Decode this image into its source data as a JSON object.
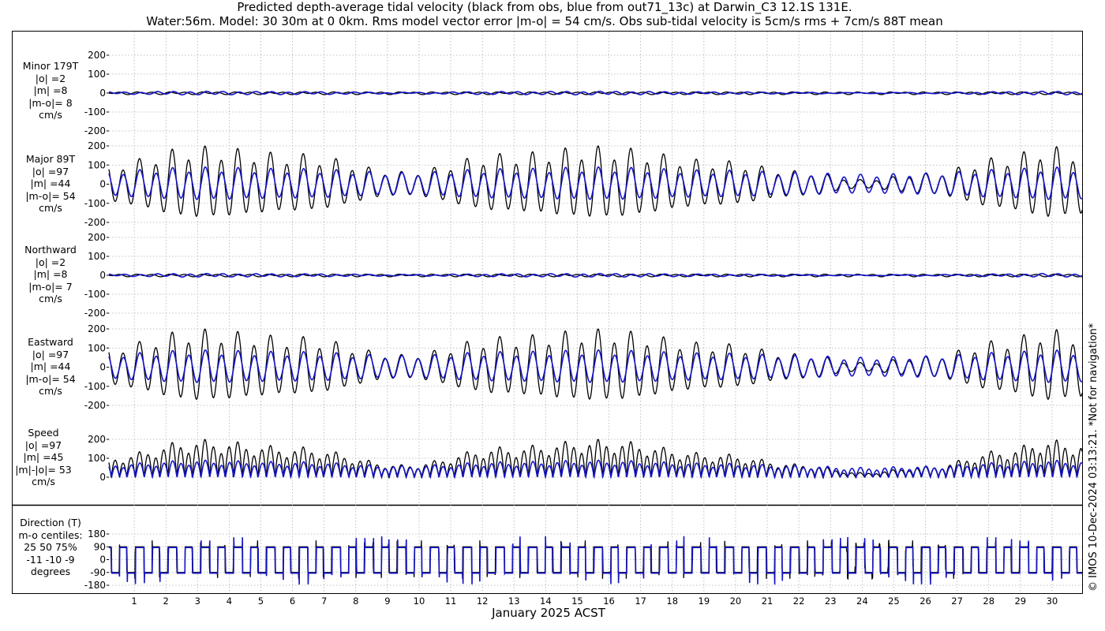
{
  "title": {
    "line1": "Predicted depth-average tidal velocity (black from obs, blue from out71_13c) at Darwin_C3 12.1S 131E.",
    "line2": "Water:56m. Model: 30 30m at 0 0km. Rms model vector error |m-o| = 54 cm/s. Obs sub-tidal velocity is 5cm/s rms + 7cm/s 88T mean"
  },
  "credit": "© IMOS 10-Dec-2024 03:13:21. *Not for navigation*",
  "colors": {
    "obs": "#000000",
    "model": "#1515c8",
    "grid": "#b0b0b0"
  },
  "chart_data": {
    "type": "line",
    "xlabel": "January 2025 ACST",
    "x_ticks": [
      "1",
      "2",
      "3",
      "4",
      "5",
      "6",
      "7",
      "8",
      "9",
      "10",
      "11",
      "12",
      "13",
      "14",
      "15",
      "16",
      "17",
      "18",
      "19",
      "20",
      "21",
      "22",
      "23",
      "24",
      "25",
      "26",
      "27",
      "28",
      "29",
      "30"
    ],
    "xlim": [
      0.2,
      30.95
    ],
    "grid": true,
    "series_styles": [
      {
        "name": "obs",
        "color": "#000000"
      },
      {
        "name": "model",
        "color": "#1515c8"
      }
    ],
    "panels": [
      {
        "id": "minor",
        "label_lines": [
          "Minor 179T",
          "|o| =2",
          "|m| =8",
          "|m-o|= 8",
          "cm/s"
        ],
        "ylim": [
          -200,
          200
        ],
        "y_ticks": [
          "200",
          "100",
          "0",
          "-100",
          "-200"
        ],
        "y_tick_values": [
          200,
          100,
          0,
          -100,
          -200
        ],
        "mode": "minor"
      },
      {
        "id": "major",
        "label_lines": [
          "Major 89T",
          "|o| =97",
          "|m| =44",
          "|m-o|= 54",
          "cm/s"
        ],
        "ylim": [
          -200,
          200
        ],
        "y_ticks": [
          "200",
          "100",
          "0",
          "-100",
          "-200"
        ],
        "y_tick_values": [
          200,
          100,
          0,
          -100,
          -200
        ],
        "mode": "major"
      },
      {
        "id": "northward",
        "label_lines": [
          "Northward",
          "|o| =2",
          "|m| =8",
          "|m-o|= 7",
          "cm/s"
        ],
        "ylim": [
          -200,
          200
        ],
        "y_ticks": [
          "200",
          "100",
          "0",
          "-100",
          "-200"
        ],
        "y_tick_values": [
          200,
          100,
          0,
          -100,
          -200
        ],
        "mode": "minor"
      },
      {
        "id": "eastward",
        "label_lines": [
          "Eastward",
          "|o| =97",
          "|m| =44",
          "|m-o|= 54",
          "cm/s"
        ],
        "ylim": [
          -200,
          200
        ],
        "y_ticks": [
          "200",
          "100",
          "0",
          "-100",
          "-200"
        ],
        "y_tick_values": [
          200,
          100,
          0,
          -100,
          -200
        ],
        "mode": "major"
      },
      {
        "id": "speed",
        "label_lines": [
          "Speed",
          "|o| =97",
          "|m| =45",
          "|m|-|o|= 53",
          "cm/s"
        ],
        "ylim": [
          0,
          200
        ],
        "y_ticks": [
          "200",
          "100",
          "0"
        ],
        "y_tick_values": [
          200,
          100,
          0
        ],
        "mode": "speed"
      },
      {
        "id": "direction",
        "label_lines": [
          "Direction (T)",
          "m-o centiles:",
          "25  50  75%",
          "-11 -10  -9",
          "degrees"
        ],
        "ylim": [
          -180,
          180
        ],
        "y_ticks": [
          "180",
          "90",
          "0",
          "-90",
          "-180"
        ],
        "y_tick_values": [
          180,
          90,
          0,
          -90,
          -180
        ],
        "mode": "direction"
      }
    ],
    "tidal_model": {
      "obs_peak_range_cm_s": [
        40,
        200
      ],
      "model_peak_range_cm_s": [
        25,
        90
      ],
      "spring_days": [
        3.0,
        15.7,
        29.8
      ],
      "neap_days": [
        9.5,
        24.0
      ],
      "period_hours": 12.42,
      "direction_levels_deg": [
        90,
        -90
      ]
    }
  }
}
